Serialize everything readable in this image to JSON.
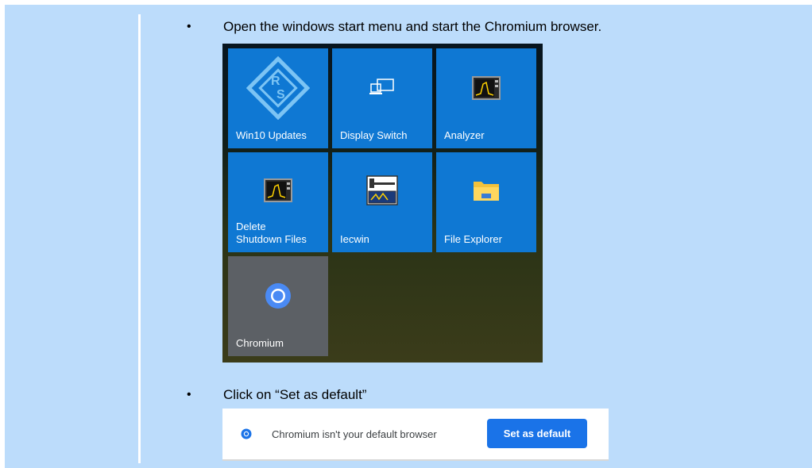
{
  "steps": [
    {
      "text": "Open the windows start menu and start the Chromium browser."
    },
    {
      "text": "Click on “Set as default”"
    }
  ],
  "tiles": [
    {
      "label": "Win10 Updates",
      "icon": "rs-logo-icon"
    },
    {
      "label": "Display Switch",
      "icon": "display-switch-icon"
    },
    {
      "label": "Analyzer",
      "icon": "analyzer-icon"
    },
    {
      "label": "Delete\nShutdown Files",
      "icon": "analyzer-icon"
    },
    {
      "label": "Iecwin",
      "icon": "iecwin-icon"
    },
    {
      "label": "File Explorer",
      "icon": "folder-icon"
    },
    {
      "label": "Chromium",
      "icon": "chromium-icon"
    }
  ],
  "infobar": {
    "message": "Chromium isn't your default browser",
    "button_label": "Set as default"
  },
  "colors": {
    "panel": "#bcdcfb",
    "tile_blue": "#0f78d3",
    "tile_gray": "#5c6065",
    "button_blue": "#1a73e8"
  }
}
